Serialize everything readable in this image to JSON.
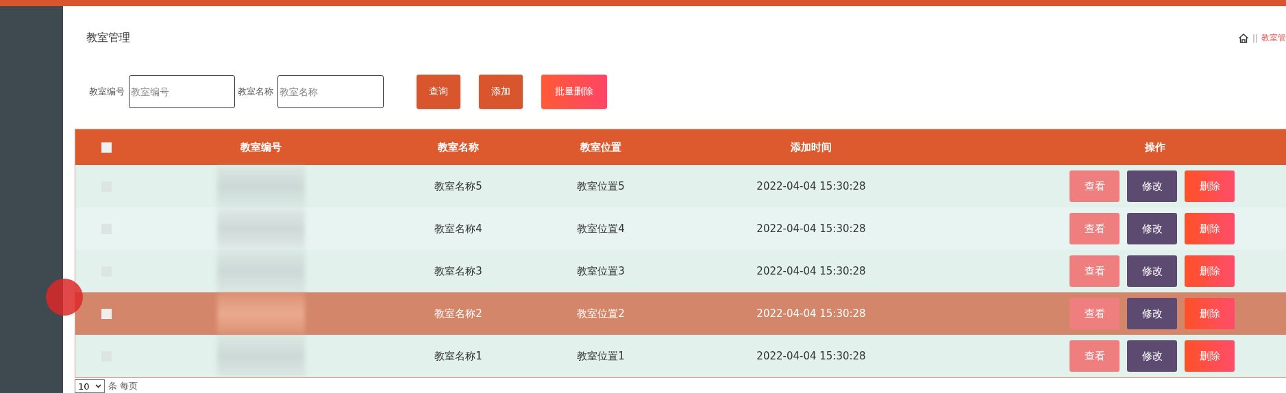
{
  "page_title": "教室管理",
  "breadcrumb": {
    "separator": "||",
    "current": "教室管"
  },
  "search": {
    "fields": [
      {
        "label": "教室编号",
        "placeholder": "教室编号"
      },
      {
        "label": "教室名称",
        "placeholder": "教室名称"
      }
    ],
    "buttons": [
      {
        "label": "查询",
        "kind": "query"
      },
      {
        "label": "添加",
        "kind": "add"
      },
      {
        "label": "批量删除",
        "kind": "batch-delete"
      }
    ]
  },
  "table": {
    "select_all_checked": false,
    "columns": [
      "教室编号",
      "教室名称",
      "教室位置",
      "添加时间",
      "操作"
    ],
    "rows": [
      {
        "name": "教室名称5",
        "location": "教室位置5",
        "added": "2022-04-04 15:30:28",
        "selected": false,
        "actions": [
          "查看",
          "修改",
          "删除"
        ]
      },
      {
        "name": "教室名称4",
        "location": "教室位置4",
        "added": "2022-04-04 15:30:28",
        "selected": false,
        "actions": [
          "查看",
          "修改",
          "删除"
        ]
      },
      {
        "name": "教室名称3",
        "location": "教室位置3",
        "added": "2022-04-04 15:30:28",
        "selected": false,
        "actions": [
          "查看",
          "修改",
          "删除"
        ]
      },
      {
        "name": "教室名称2",
        "location": "教室位置2",
        "added": "2022-04-04 15:30:28",
        "selected": true,
        "actions": [
          "查看",
          "修改",
          "删除"
        ]
      },
      {
        "name": "教室名称1",
        "location": "教室位置1",
        "added": "2022-04-04 15:30:28",
        "selected": false,
        "actions": [
          "查看",
          "修改",
          "删除"
        ]
      }
    ]
  },
  "pagination": {
    "page_size": "10",
    "label": "条 每页"
  }
}
